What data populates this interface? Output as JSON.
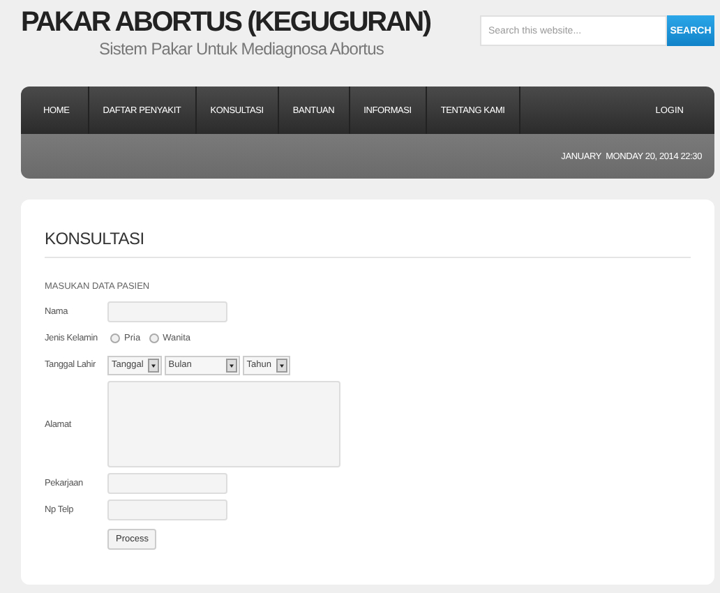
{
  "header": {
    "title": "PAKAR ABORTUS (KEGUGURAN)",
    "subtitle": "Sistem Pakar Untuk Mediagnosa Abortus"
  },
  "search": {
    "placeholder": "Search this website...",
    "button": "SEARCH"
  },
  "nav": {
    "items": [
      {
        "label": "HOME"
      },
      {
        "label": "DAFTAR PENYAKIT"
      },
      {
        "label": "KONSULTASI"
      },
      {
        "label": "BANTUAN"
      },
      {
        "label": "INFORMASI"
      },
      {
        "label": "TENTANG KAMI"
      }
    ],
    "login": "LOGIN",
    "date": "JANUARY  MONDAY 20, 2014 22:30"
  },
  "content": {
    "heading": "KONSULTASI",
    "section": "MASUKAN DATA PASIEN",
    "fields": [
      {
        "kind": "text",
        "label": "Nama"
      },
      {
        "kind": "radio",
        "label": "Jenis Kelamin",
        "options": [
          {
            "label": "Pria",
            "selected": false
          },
          {
            "label": "Wanita",
            "selected": false
          }
        ]
      },
      {
        "kind": "selects",
        "label": "Tanggal Lahir",
        "selects": [
          {
            "value": "Tanggal"
          },
          {
            "value": "Bulan"
          },
          {
            "value": "Tahun"
          }
        ]
      },
      {
        "kind": "textarea",
        "label": "Alamat"
      },
      {
        "kind": "text",
        "label": "Pekarjaan"
      },
      {
        "kind": "text",
        "label": "Np Telp"
      }
    ],
    "button": "Process"
  }
}
